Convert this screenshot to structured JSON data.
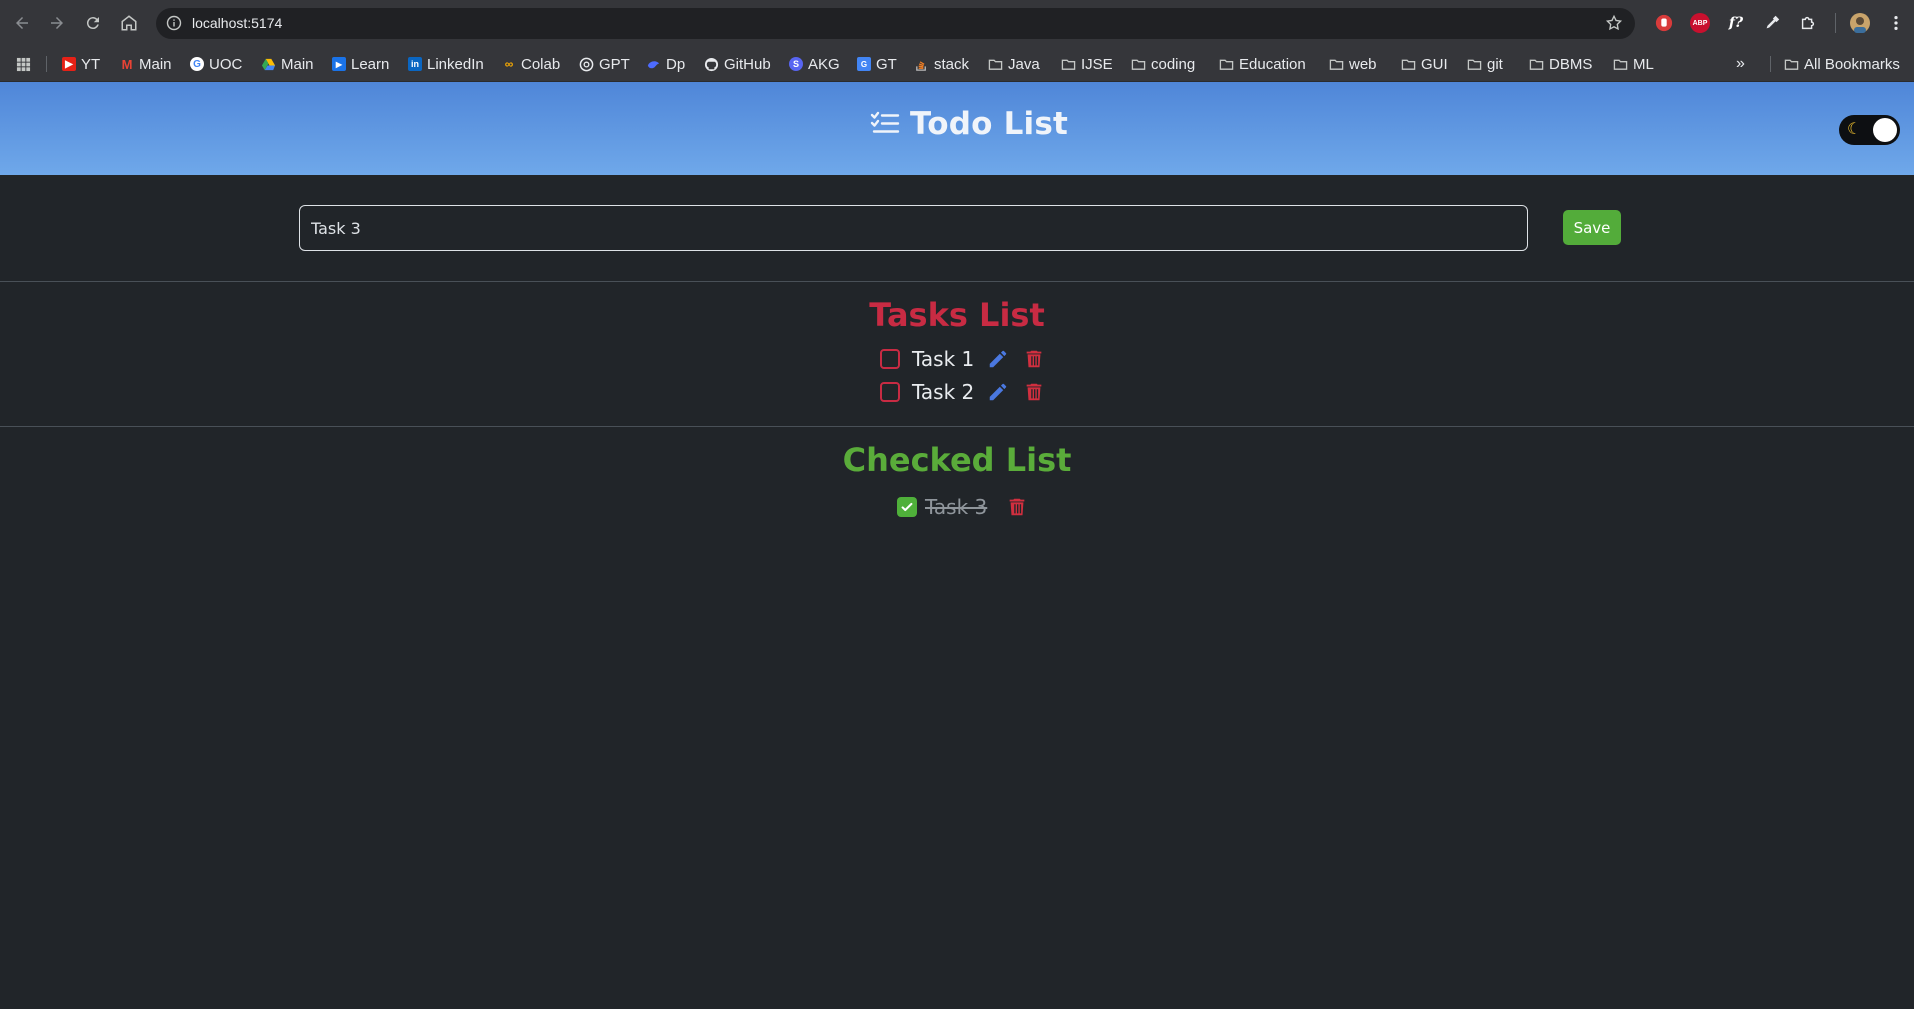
{
  "browser": {
    "url": "localhost:5174",
    "bookmarks": [
      {
        "label": "YT",
        "icon": "youtube-icon"
      },
      {
        "label": "Main",
        "icon": "gmail-icon"
      },
      {
        "label": "UOC",
        "icon": "google-icon"
      },
      {
        "label": "Main",
        "icon": "drive-icon"
      },
      {
        "label": "Learn",
        "icon": "learn-icon"
      },
      {
        "label": "LinkedIn",
        "icon": "linkedin-icon"
      },
      {
        "label": "Colab",
        "icon": "colab-icon"
      },
      {
        "label": "GPT",
        "icon": "openai-icon"
      },
      {
        "label": "Dp",
        "icon": "deepseek-icon"
      },
      {
        "label": "GitHub",
        "icon": "github-icon"
      },
      {
        "label": "AKG",
        "icon": "akg-icon"
      },
      {
        "label": "GT",
        "icon": "translate-icon"
      },
      {
        "label": "stack",
        "icon": "stackoverflow-icon"
      },
      {
        "label": "Java",
        "icon": "folder-icon"
      },
      {
        "label": "IJSE",
        "icon": "folder-icon"
      },
      {
        "label": "coding",
        "icon": "folder-icon"
      },
      {
        "label": "Education",
        "icon": "folder-icon"
      },
      {
        "label": "web",
        "icon": "folder-icon"
      },
      {
        "label": "GUI",
        "icon": "folder-icon"
      },
      {
        "label": "git",
        "icon": "folder-icon"
      },
      {
        "label": "DBMS",
        "icon": "folder-icon"
      },
      {
        "label": "ML",
        "icon": "folder-icon"
      }
    ],
    "all_bookmarks": "All Bookmarks",
    "extensions": {
      "abp": "ABP",
      "fx": "f?"
    }
  },
  "app": {
    "title": "Todo List",
    "theme": "dark",
    "input": {
      "value": "Task 3"
    },
    "save_label": "Save",
    "tasks_title": "Tasks List",
    "tasks": [
      {
        "label": "Task 1",
        "checked": false
      },
      {
        "label": "Task 2",
        "checked": false
      }
    ],
    "checked_title": "Checked List",
    "checked": [
      {
        "label": "Task 3",
        "checked": true
      }
    ]
  },
  "colors": {
    "header_gradient_start": "#4f86d8",
    "header_gradient_end": "#6fa8ea",
    "background": "#212529",
    "tasks_title": "#c82b43",
    "checked_title": "#5aac3a",
    "save_button": "#53ac3a",
    "edit_icon": "#4a78e0",
    "delete_icon": "#d12f3f"
  }
}
